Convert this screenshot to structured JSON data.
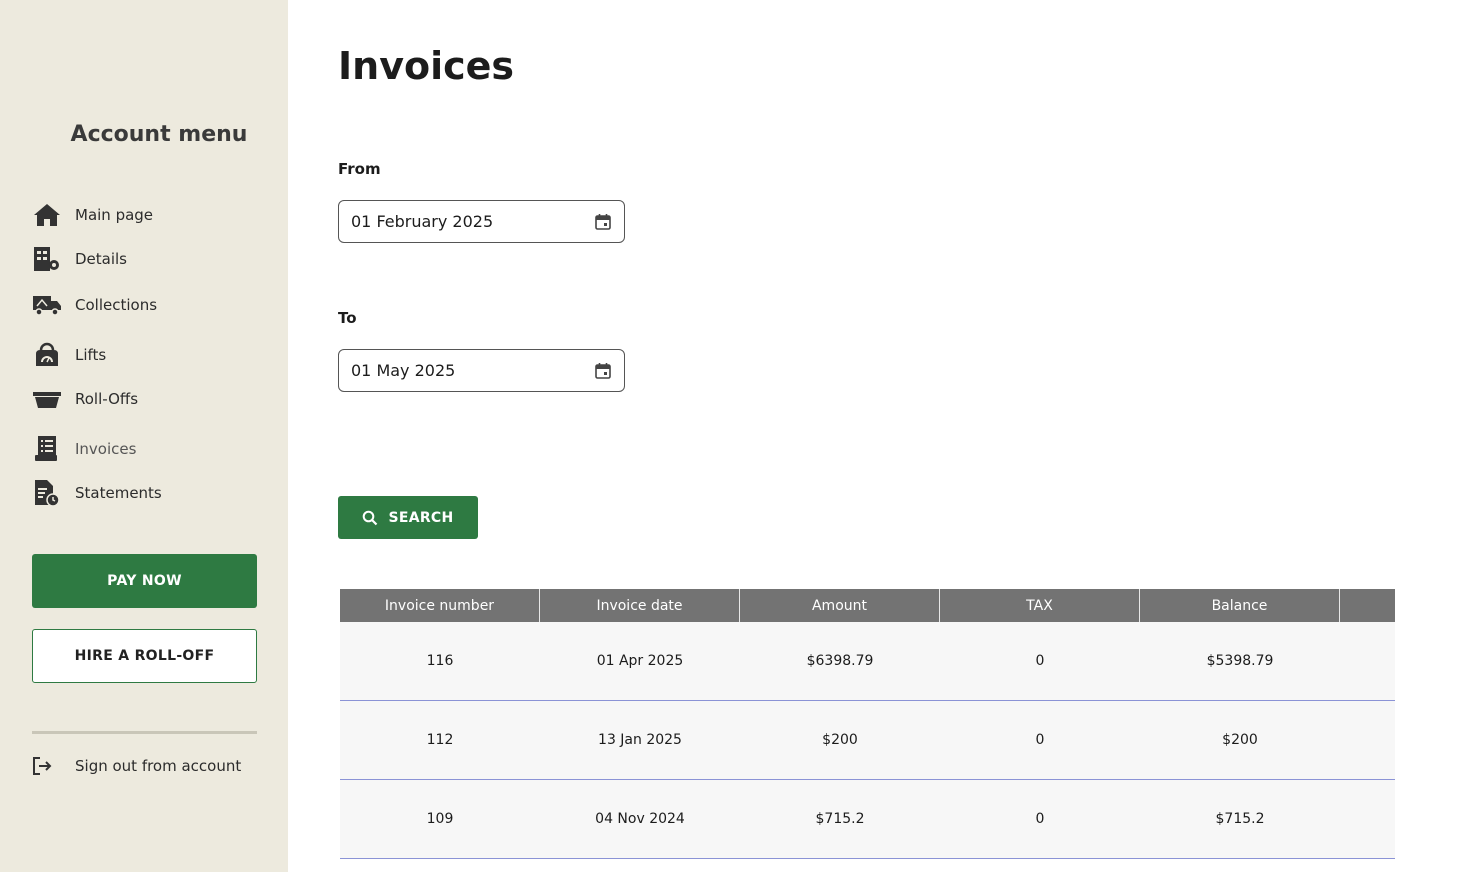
{
  "sidebar": {
    "title": "Account menu",
    "items": [
      {
        "label": "Main page",
        "icon": "home-icon"
      },
      {
        "label": "Details",
        "icon": "building-gear-icon"
      },
      {
        "label": "Collections",
        "icon": "truck-icon"
      },
      {
        "label": "Lifts",
        "icon": "bin-lift-icon"
      },
      {
        "label": "Roll-Offs",
        "icon": "dumpster-icon"
      },
      {
        "label": "Invoices",
        "icon": "invoice-icon"
      },
      {
        "label": "Statements",
        "icon": "statement-clock-icon"
      }
    ],
    "active_item": "Invoices",
    "pay_now_label": "PAY NOW",
    "hire_label": "HIRE A ROLL-OFF",
    "sign_out_label": "Sign out from account"
  },
  "main": {
    "title": "Invoices",
    "from_label": "From",
    "from_value": "01 February 2025",
    "to_label": "To",
    "to_value": "01 May 2025",
    "search_label": "SEARCH"
  },
  "table": {
    "columns": [
      "Invoice number",
      "Invoice date",
      "Amount",
      "TAX",
      "Balance",
      ""
    ],
    "rows": [
      [
        "116",
        "01 Apr 2025",
        "$6398.79",
        "0",
        "$5398.79",
        ""
      ],
      [
        "112",
        "13 Jan 2025",
        "$200",
        "0",
        "$200",
        ""
      ],
      [
        "109",
        "04 Nov 2024",
        "$715.2",
        "0",
        "$715.2",
        ""
      ]
    ]
  },
  "colors": {
    "sidebar_bg": "#edeade",
    "primary_green": "#2e7a42",
    "table_header": "#737373",
    "row_divider": "#8b93d6"
  }
}
